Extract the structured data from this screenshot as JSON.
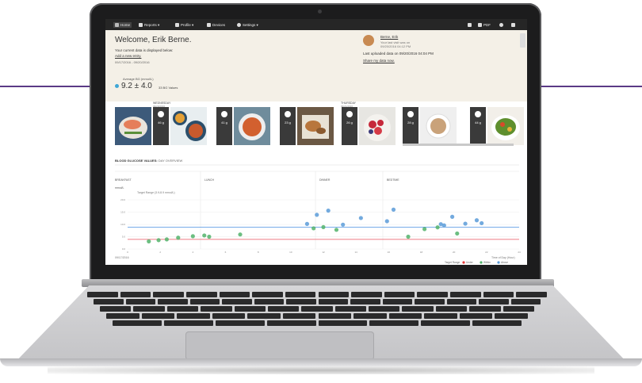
{
  "nav": {
    "home": "Home",
    "reports": "Reports",
    "profile": "Profile",
    "devices": "Devices",
    "settings": "Settings",
    "pdf": "PDF"
  },
  "welcome": {
    "title": "Welcome, Erik Berne.",
    "subtitle": "Your current data is displayed below:",
    "add_entry": "Add a new entry.",
    "date_range": "09/17/2016 - 09/20/2016",
    "avg_label": "Average BG (mmol/L)",
    "avg_value": "9.2 ± 4.0",
    "bg_values": "33 BG Values"
  },
  "profile_card": {
    "name": "Berne, Erik",
    "last_seen_label": "Your last visit was on",
    "last_seen": "09/20/2016 04:12 PM",
    "uploaded": "Last uploaded data on 09/20/2016 04:04 PM",
    "share": "Share my data now."
  },
  "days": {
    "wednesday": "WEDNESDAY",
    "wednesday_date": "09/20/2016",
    "thursday": "THURSDAY",
    "thursday_date": "09/21/2016"
  },
  "meals": [
    "46 g",
    "41 g",
    "23 g",
    "26 g",
    "28 g",
    "44 g"
  ],
  "chart": {
    "section_title_bold": "BLOOD GLUCOSE VALUES:",
    "section_title": "DAY OVERVIEW",
    "phases": [
      "BREAKFAST",
      "LUNCH",
      "DINNER",
      "BEDTIME"
    ],
    "unit": "mmol/L",
    "target_range": "Target Range (3.9-8.9 mmol/L)",
    "date_label": "09/17/2016",
    "time_label": "Time of Day (Hour)",
    "legend_title": "Target Range",
    "legend": [
      "Under",
      "Within",
      "Above"
    ]
  },
  "colors": {
    "nav_bg": "#262626",
    "welcome_bg": "#f4f0e7",
    "within": "#52b36b",
    "above": "#5b9bd8",
    "under": "#e53b3b",
    "target_low": "#e8505b",
    "target_high": "#4a90e2",
    "accent_line": "#5b3a86"
  },
  "chart_data": {
    "type": "scatter",
    "xlabel": "Time of Day (Hour)",
    "ylabel": "mmol/L",
    "xlim": [
      0,
      24
    ],
    "ylim": [
      0,
      20
    ],
    "x_ticks": [
      0,
      2,
      4,
      6,
      8,
      10,
      12,
      14,
      16,
      18,
      20,
      22,
      24
    ],
    "y_ticks": [
      0,
      5,
      10,
      15,
      20
    ],
    "target_lines": [
      3.9,
      8.9
    ],
    "series": [
      {
        "name": "Within",
        "color": "#52b36b",
        "points": [
          [
            1.3,
            3.1
          ],
          [
            1.9,
            3.6
          ],
          [
            2.4,
            3.9
          ],
          [
            3.1,
            4.6
          ],
          [
            4.0,
            5.2
          ],
          [
            4.7,
            5.5
          ],
          [
            5.0,
            5.0
          ],
          [
            6.9,
            5.9
          ],
          [
            11.4,
            8.4
          ],
          [
            12.0,
            8.9
          ],
          [
            12.8,
            7.8
          ],
          [
            17.2,
            5.0
          ],
          [
            18.2,
            8.1
          ],
          [
            19.0,
            8.8
          ],
          [
            20.2,
            6.3
          ]
        ]
      },
      {
        "name": "Above",
        "color": "#5b9bd8",
        "points": [
          [
            11.0,
            10.2
          ],
          [
            11.6,
            13.9
          ],
          [
            12.3,
            15.6
          ],
          [
            13.2,
            9.9
          ],
          [
            14.3,
            12.6
          ],
          [
            15.9,
            11.3
          ],
          [
            16.3,
            16.0
          ],
          [
            19.2,
            10.1
          ],
          [
            19.9,
            13.1
          ],
          [
            19.4,
            9.6
          ],
          [
            20.7,
            10.3
          ],
          [
            21.4,
            11.7
          ],
          [
            21.7,
            10.5
          ]
        ]
      }
    ]
  }
}
